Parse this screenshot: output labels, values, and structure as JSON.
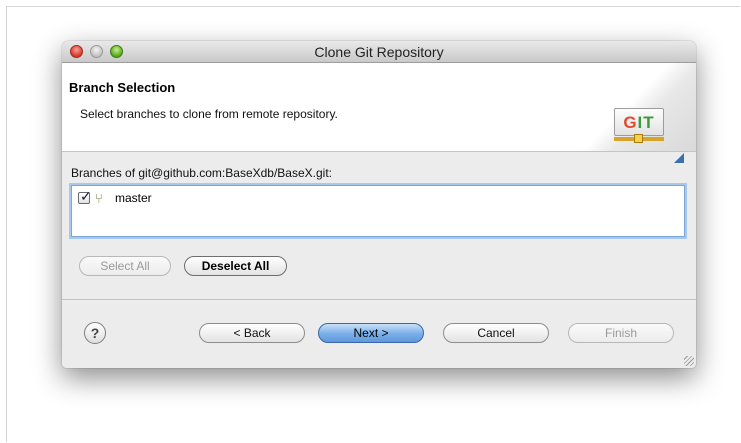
{
  "window": {
    "title": "Clone Git Repository"
  },
  "banner": {
    "title": "Branch Selection",
    "description": "Select branches to clone from remote repository.",
    "logo_text": [
      "G",
      "I",
      "T"
    ]
  },
  "branches": {
    "label": "Branches of git@github.com:BaseXdb/BaseX.git:",
    "items": [
      {
        "name": "master",
        "checked": true
      }
    ],
    "select_all_label": "Select All",
    "deselect_all_label": "Deselect All"
  },
  "footer": {
    "help_glyph": "?",
    "back_label": "< Back",
    "next_label": "Next >",
    "cancel_label": "Cancel",
    "finish_label": "Finish"
  },
  "colors": {
    "default_button": "#79aee8",
    "list_focus_border": "#7aa7d7"
  }
}
